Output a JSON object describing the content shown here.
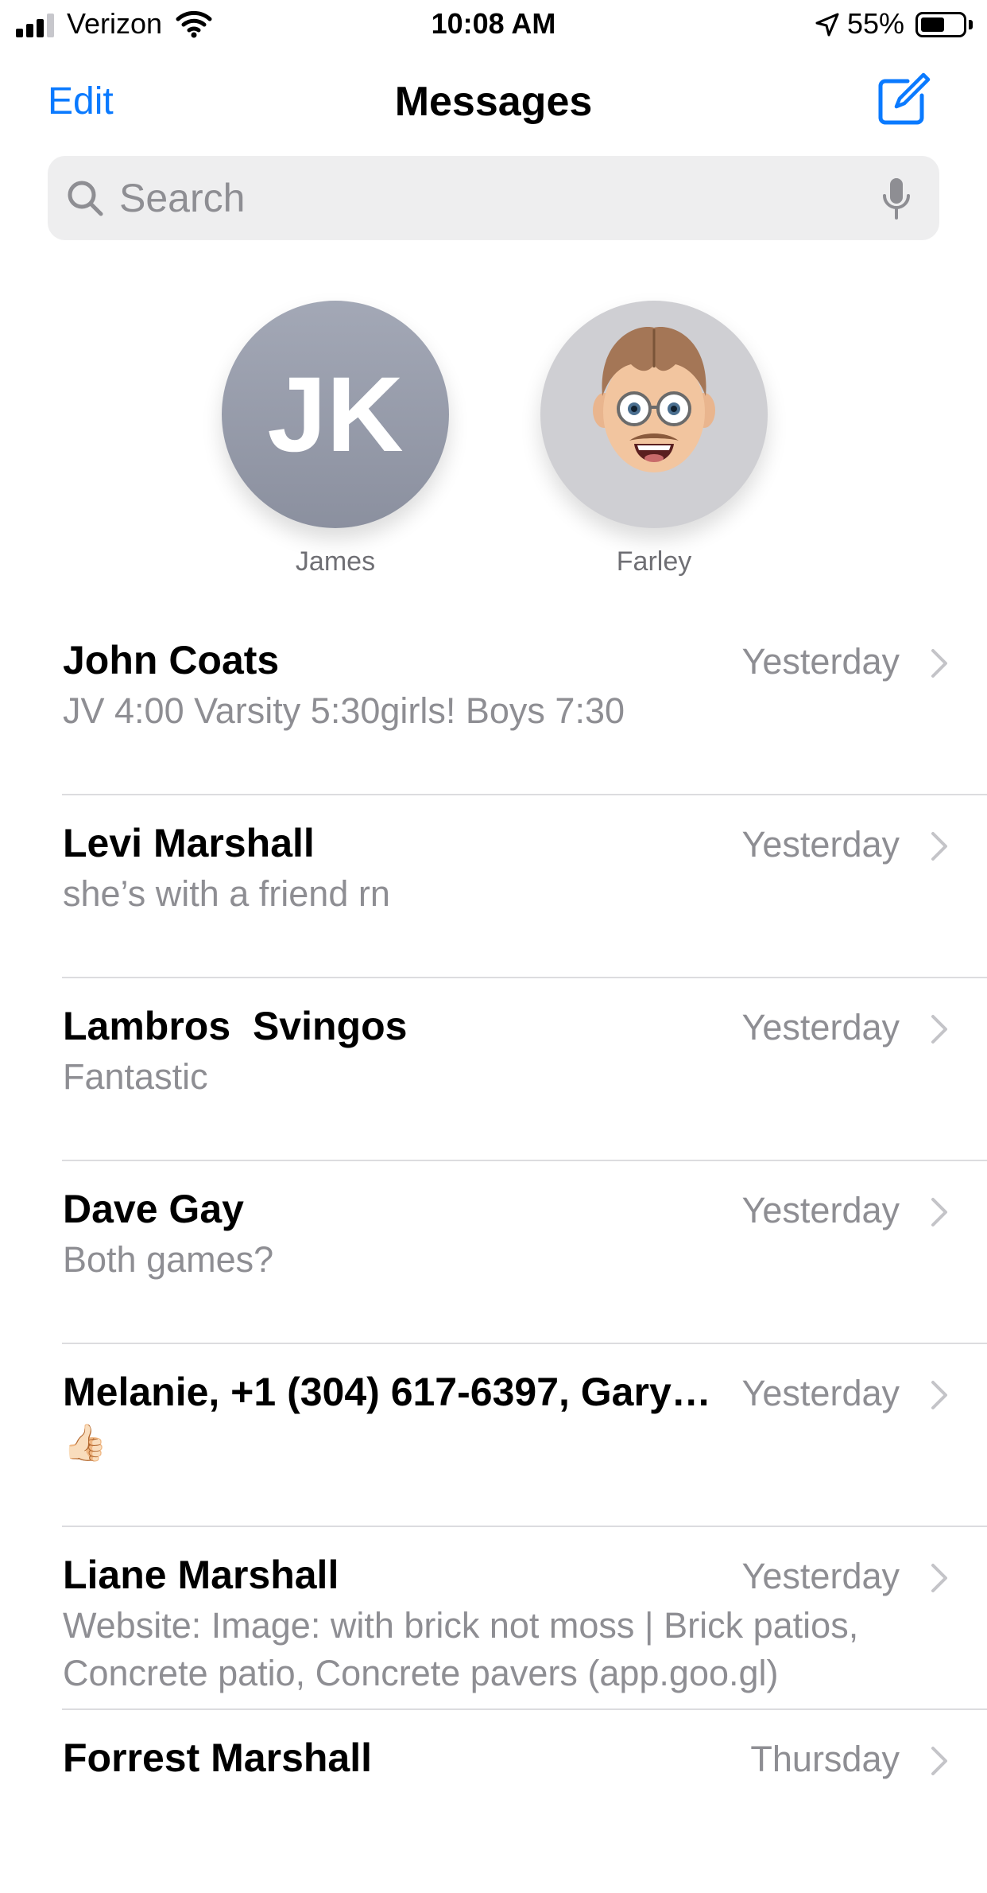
{
  "status_bar": {
    "carrier": "Verizon",
    "time": "10:08 AM",
    "battery_percent": "55%",
    "battery_level": 0.55,
    "icons": [
      "signal-icon",
      "wifi-icon",
      "location-icon",
      "battery-icon"
    ]
  },
  "nav": {
    "edit_label": "Edit",
    "title": "Messages",
    "compose_icon": "compose-icon"
  },
  "search": {
    "placeholder": "Search",
    "icons": [
      "search-icon",
      "microphone-icon"
    ]
  },
  "pinned": [
    {
      "initials": "JK",
      "name": "James"
    },
    {
      "name": "Farley",
      "avatar": "memoji"
    }
  ],
  "conversations": [
    {
      "name": "John Coats",
      "time": "Yesterday",
      "preview": "JV 4:00 Varsity 5:30girls! Boys 7:30"
    },
    {
      "name": "Levi Marshall",
      "time": "Yesterday",
      "preview": "she’s with a friend rn"
    },
    {
      "name": "Lambros  Svingos",
      "time": "Yesterday",
      "preview": "Fantastic"
    },
    {
      "name": "Dave Gay",
      "time": "Yesterday",
      "preview": "Both games?"
    },
    {
      "name": "Melanie, +1 (304) 617-6397, Gary…",
      "time": "Yesterday",
      "preview": "👍🏻"
    },
    {
      "name": "Liane Marshall",
      "time": "Yesterday",
      "preview": "Website: Image: with brick not moss | Brick patios, Concrete patio, Concrete pavers (app.goo.gl)"
    },
    {
      "name": "Forrest Marshall",
      "time": "Thursday",
      "preview": ""
    }
  ],
  "colors": {
    "accent": "#0a7aff",
    "secondary_text": "#8e8e93",
    "search_bg": "#eeeeef",
    "divider": "#dcdcdf"
  }
}
